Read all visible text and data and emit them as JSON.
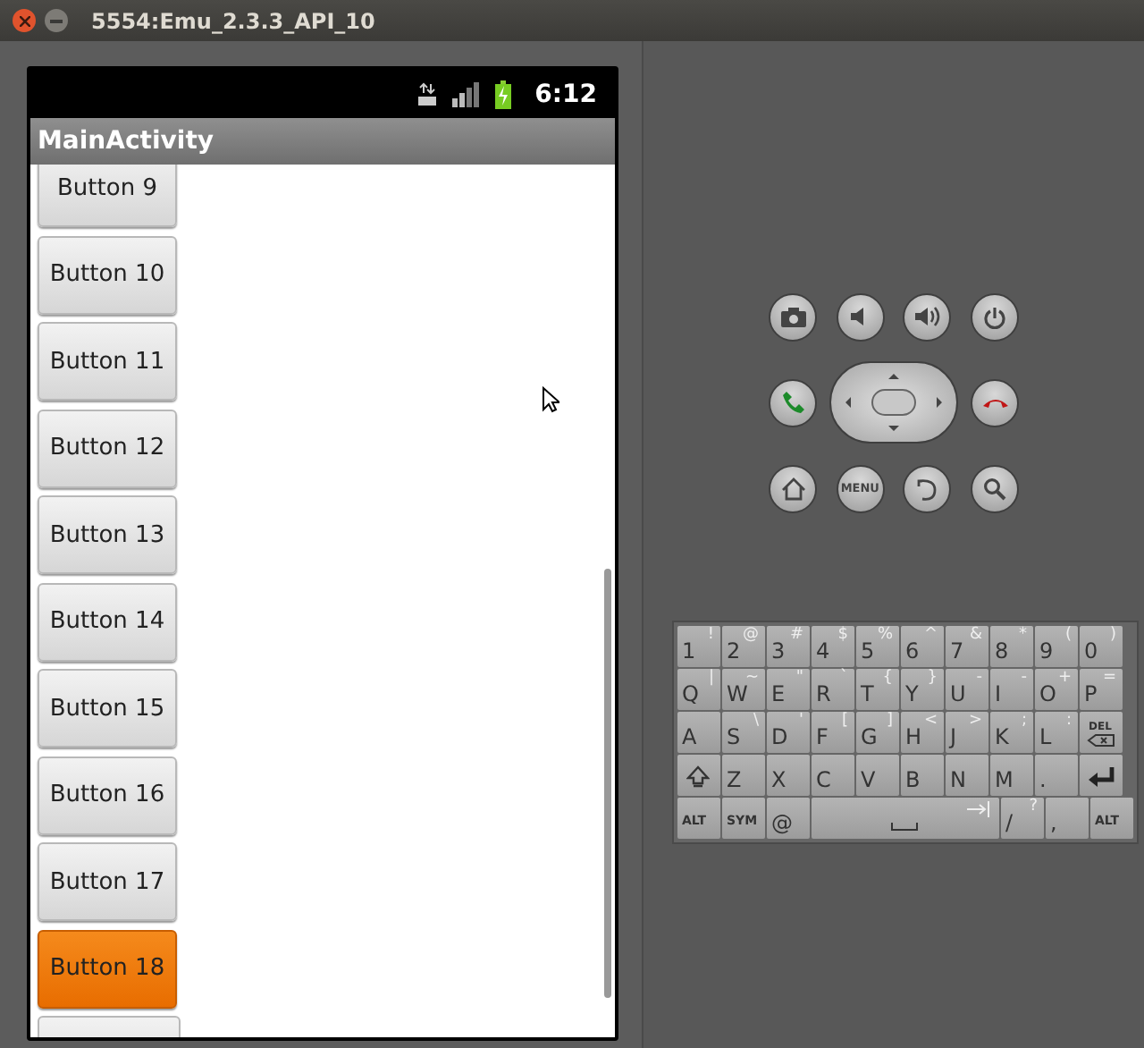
{
  "window": {
    "title": "5554:Emu_2.3.3_API_10"
  },
  "status_bar": {
    "time": "6:12"
  },
  "app_bar": {
    "title": "MainActivity"
  },
  "buttons": [
    {
      "label": "Button 9",
      "focused": false
    },
    {
      "label": "Button 10",
      "focused": false
    },
    {
      "label": "Button 11",
      "focused": false
    },
    {
      "label": "Button 12",
      "focused": false
    },
    {
      "label": "Button 13",
      "focused": false
    },
    {
      "label": "Button 14",
      "focused": false
    },
    {
      "label": "Button 15",
      "focused": false
    },
    {
      "label": "Button 16",
      "focused": false
    },
    {
      "label": "Button 17",
      "focused": false
    },
    {
      "label": "Button 18",
      "focused": true
    }
  ],
  "controls": [
    [
      {
        "kind": "camera"
      },
      {
        "kind": "volume-down"
      },
      {
        "kind": "volume-up"
      },
      {
        "kind": "power"
      }
    ],
    [
      {
        "kind": "call"
      },
      {
        "kind": "dpad"
      },
      {
        "kind": "end-call"
      }
    ],
    [
      {
        "kind": "home"
      },
      {
        "kind": "menu",
        "label": "MENU"
      },
      {
        "kind": "back"
      },
      {
        "kind": "search"
      }
    ]
  ],
  "keyboard": [
    [
      {
        "kind": "char",
        "label": "1",
        "alt": "!"
      },
      {
        "kind": "char",
        "label": "2",
        "alt": "@"
      },
      {
        "kind": "char",
        "label": "3",
        "alt": "#"
      },
      {
        "kind": "char",
        "label": "4",
        "alt": "$"
      },
      {
        "kind": "char",
        "label": "5",
        "alt": "%"
      },
      {
        "kind": "char",
        "label": "6",
        "alt": "^"
      },
      {
        "kind": "char",
        "label": "7",
        "alt": "&"
      },
      {
        "kind": "char",
        "label": "8",
        "alt": "*"
      },
      {
        "kind": "char",
        "label": "9",
        "alt": "("
      },
      {
        "kind": "char",
        "label": "0",
        "alt": ")"
      }
    ],
    [
      {
        "kind": "char",
        "label": "Q",
        "alt": "|"
      },
      {
        "kind": "char",
        "label": "W",
        "alt": "~"
      },
      {
        "kind": "char",
        "label": "E",
        "alt": "\""
      },
      {
        "kind": "char",
        "label": "R",
        "alt": "`"
      },
      {
        "kind": "char",
        "label": "T",
        "alt": "{"
      },
      {
        "kind": "char",
        "label": "Y",
        "alt": "}"
      },
      {
        "kind": "char",
        "label": "U",
        "alt": "-"
      },
      {
        "kind": "char",
        "label": "I",
        "alt": "-"
      },
      {
        "kind": "char",
        "label": "O",
        "alt": "+"
      },
      {
        "kind": "char",
        "label": "P",
        "alt": "="
      }
    ],
    [
      {
        "kind": "char",
        "label": "A"
      },
      {
        "kind": "char",
        "label": "S",
        "alt": "\\"
      },
      {
        "kind": "char",
        "label": "D",
        "alt": "'"
      },
      {
        "kind": "char",
        "label": "F",
        "alt": "["
      },
      {
        "kind": "char",
        "label": "G",
        "alt": "]"
      },
      {
        "kind": "char",
        "label": "H",
        "alt": "<"
      },
      {
        "kind": "char",
        "label": "J",
        "alt": ">"
      },
      {
        "kind": "char",
        "label": "K",
        "alt": ";"
      },
      {
        "kind": "char",
        "label": "L",
        "alt": ":"
      },
      {
        "kind": "del",
        "label": "DEL"
      }
    ],
    [
      {
        "kind": "shift"
      },
      {
        "kind": "char",
        "label": "Z"
      },
      {
        "kind": "char",
        "label": "X"
      },
      {
        "kind": "char",
        "label": "C"
      },
      {
        "kind": "char",
        "label": "V"
      },
      {
        "kind": "char",
        "label": "B"
      },
      {
        "kind": "char",
        "label": "N"
      },
      {
        "kind": "char",
        "label": "M"
      },
      {
        "kind": "char",
        "label": "."
      },
      {
        "kind": "enter"
      }
    ],
    [
      {
        "kind": "small",
        "label": "ALT"
      },
      {
        "kind": "small",
        "label": "SYM"
      },
      {
        "kind": "char",
        "label": "@"
      },
      {
        "kind": "space"
      },
      {
        "kind": "char",
        "label": "/",
        "alt": "?"
      },
      {
        "kind": "char",
        "label": ","
      },
      {
        "kind": "small",
        "label": "ALT"
      }
    ]
  ]
}
